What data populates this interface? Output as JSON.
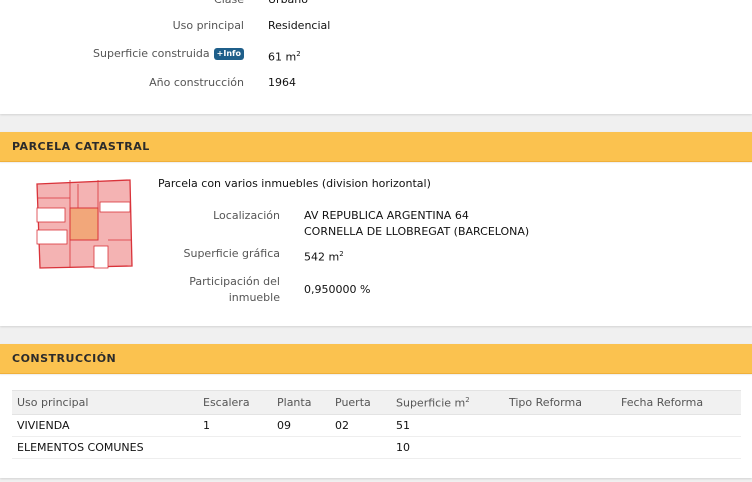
{
  "top_panel": {
    "rows": [
      {
        "label": "Clase",
        "value": "Urbano"
      },
      {
        "label": "Uso principal",
        "value": "Residencial"
      },
      {
        "label": "Superficie construida",
        "badge": "+Info",
        "value": "61 m",
        "value_sup": "2"
      },
      {
        "label": "Año construcción",
        "value": "1964"
      }
    ]
  },
  "parcela": {
    "header": "PARCELA CATASTRAL",
    "description": "Parcela con varios inmuebles (division horizontal)",
    "localizacion_label": "Localización",
    "localizacion_line1": "AV REPUBLICA ARGENTINA 64",
    "localizacion_line2": "CORNELLA DE LLOBREGAT (BARCELONA)",
    "superficie_label": "Superficie gráfica",
    "superficie_value": "542 m",
    "superficie_sup": "2",
    "participacion_label_line1": "Participación del",
    "participacion_label_line2": "inmueble",
    "participacion_value": "0,950000 %",
    "map_colors": {
      "parcel": "#f4b3b3",
      "outline": "#d9333a",
      "highlight": "#f2a77a"
    }
  },
  "construccion": {
    "header": "CONSTRUCCIÓN",
    "columns": [
      "Uso principal",
      "Escalera",
      "Planta",
      "Puerta",
      "Superficie m",
      "Tipo Reforma",
      "Fecha Reforma"
    ],
    "superficie_sup": "2",
    "rows": [
      [
        "VIVIENDA",
        "1",
        "09",
        "02",
        "51",
        "",
        ""
      ],
      [
        "ELEMENTOS COMUNES",
        "",
        "",
        "",
        "10",
        "",
        ""
      ]
    ]
  },
  "colors": {
    "header_bg": "#fbc24f",
    "badge_bg": "#1f5f8a"
  }
}
